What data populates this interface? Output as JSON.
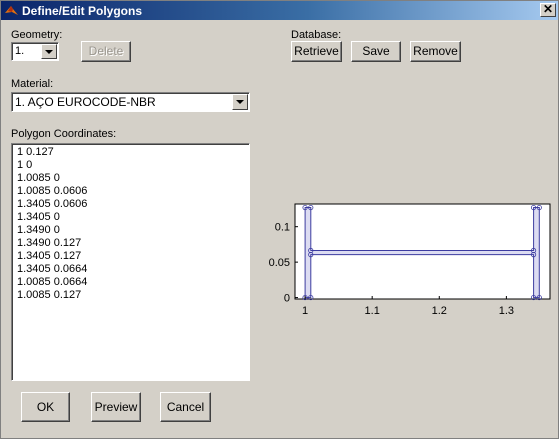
{
  "window": {
    "title": "Define/Edit Polygons",
    "close_glyph": "✕",
    "accent": "#0a246a"
  },
  "geometry": {
    "label": "Geometry:",
    "value": "1.",
    "delete_label": "Delete"
  },
  "database": {
    "label": "Database:",
    "retrieve_label": "Retrieve",
    "save_label": "Save",
    "remove_label": "Remove"
  },
  "material": {
    "label": "Material:",
    "value": "1. AÇO EUROCODE-NBR"
  },
  "coords": {
    "label": "Polygon Coordinates:",
    "lines": [
      "1 0.127",
      "1 0",
      "1.0085 0",
      "1.0085 0.0606",
      "1.3405 0.0606",
      "1.3405 0",
      "1.3490 0",
      "1.3490 0.127",
      "1.3405 0.127",
      "1.3405 0.0664",
      "1.0085 0.0664",
      "1.0085 0.127"
    ]
  },
  "buttons": {
    "ok_label": "OK",
    "preview_label": "Preview",
    "cancel_label": "Cancel"
  },
  "chart_data": {
    "type": "line",
    "x_ticks": [
      "1",
      "1.1",
      "1.2",
      "1.3"
    ],
    "y_ticks": [
      "0",
      "0.05",
      "0.1"
    ],
    "xlim": [
      0.985,
      1.365
    ],
    "ylim": [
      -0.002,
      0.132
    ],
    "line_color": "#3c3ca0",
    "fill_color": "#dcdcf2",
    "series": [
      {
        "x": [
          1,
          1,
          1.0085,
          1.0085,
          1.3405,
          1.3405,
          1.349,
          1.349,
          1.3405,
          1.3405,
          1.0085,
          1.0085,
          1
        ],
        "y": [
          0.127,
          0,
          0,
          0.0606,
          0.0606,
          0,
          0,
          0.127,
          0.127,
          0.0664,
          0.0664,
          0.127,
          0.127
        ]
      }
    ]
  }
}
